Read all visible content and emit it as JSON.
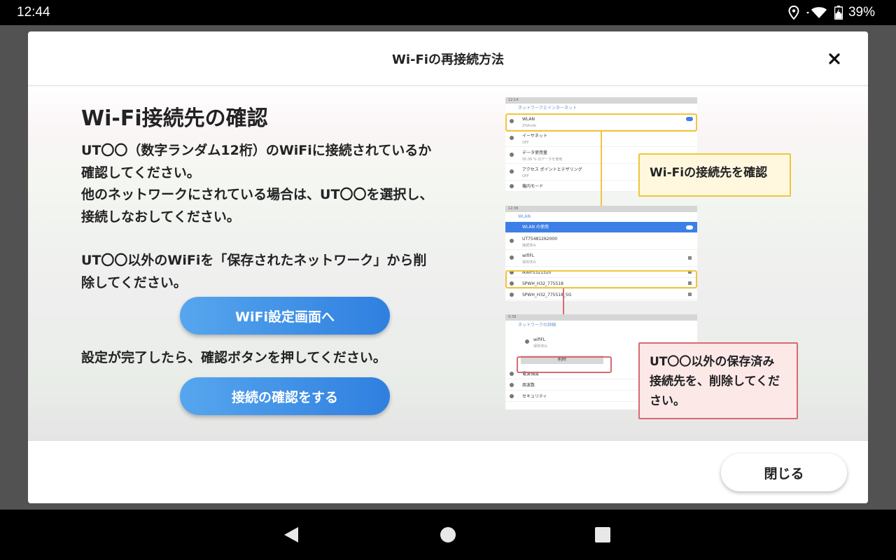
{
  "status_bar": {
    "time": "12:44",
    "battery_percent": "39%",
    "icons": [
      "location-icon",
      "wifi-signal-icon",
      "battery-charging-icon"
    ]
  },
  "dialog": {
    "title": "Wi-Fiの再接続方法",
    "close_icon": "close-icon",
    "section_title": "Wi-Fi接続先の確認",
    "instructions": [
      "UT〇〇（数字ランダム12桁）のWiFiに接続されているか\n確認してください。\n他のネットワークにされている場合は、UT〇〇を選択し、\n接続しなおしてください。",
      "UT〇〇以外のWiFiを「保存されたネットワーク」から削\n除してください。"
    ],
    "wifi_settings_button": "WiFi設定画面へ",
    "after_settings_text": "設定が完了したら、確認ボタンを押してください。",
    "confirm_button": "接続の確認をする",
    "close_button": "閉じる"
  },
  "illustration": {
    "screen1": {
      "status": "12:14",
      "title": "ネットワークとインターネット",
      "rows": [
        {
          "label": "WLAN",
          "sub": "ZHAnde"
        },
        {
          "label": "イーサネット",
          "sub": "OFF"
        },
        {
          "label": "データ使用量",
          "sub": "95.56 % のデータを使用"
        },
        {
          "label": "アクセス ポイントとテザリング",
          "sub": "OFF"
        },
        {
          "label": "機内モード",
          "sub": ""
        }
      ]
    },
    "screen2": {
      "status": "12:36",
      "title": "WLAN",
      "highlight_row": "WLAN の使用",
      "rows": [
        {
          "label": "UT75481262000",
          "sub": "接続済み"
        },
        {
          "label": "wifiFL",
          "sub": "保存済み"
        },
        {
          "label": "iKWF5321520",
          "sub": ""
        },
        {
          "label": "SPWH_H32_775518",
          "sub": ""
        },
        {
          "label": "SPWH_H32_775518_5G",
          "sub": ""
        }
      ]
    },
    "screen3": {
      "status": "0:39",
      "title": "ネットワークの詳細",
      "network_name": "wifiFL",
      "network_sub": "保存済み",
      "delete_button": "削除",
      "rows": [
        {
          "label": "電波強度"
        },
        {
          "label": "周波数"
        },
        {
          "label": "セキュリティ"
        }
      ]
    },
    "callout_yellow": "Wi-Fiの接続先を確認",
    "callout_red": "UT〇〇以外の保存済み\n接続先を、削除してくだ\nさい。"
  },
  "nav_bar": {
    "icons": [
      "back-icon",
      "home-icon",
      "recents-icon"
    ]
  }
}
